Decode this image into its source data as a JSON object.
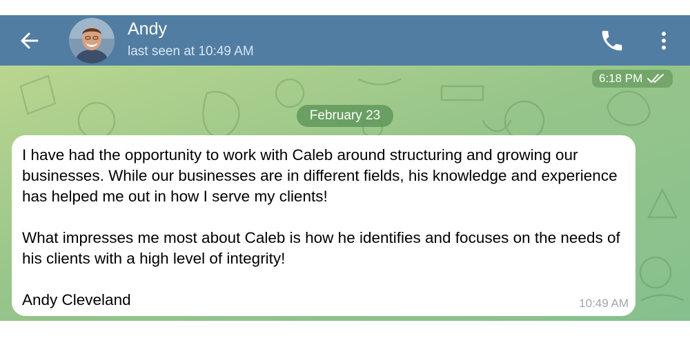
{
  "header": {
    "contact_name": "Andy",
    "status": "last seen at 10:49 AM",
    "bar_color": "#517da2"
  },
  "icons": {
    "back": "arrow-left-icon",
    "call": "phone-icon",
    "menu": "more-vertical-icon",
    "read": "double-check-icon"
  },
  "chat": {
    "previous_message_time": "6:18 PM",
    "date_separator": "February 23",
    "message": {
      "paragraph_1": "I have had the opportunity to work with Caleb around structuring and growing our businesses. While our businesses are in different fields, his knowledge and experience has helped me out in how I serve my clients!",
      "paragraph_2": "What impresses me most about Caleb is how he identifies and focuses on the needs of his clients with a high level of integrity!",
      "signature": "Andy Cleveland",
      "time": "10:49 AM"
    }
  }
}
